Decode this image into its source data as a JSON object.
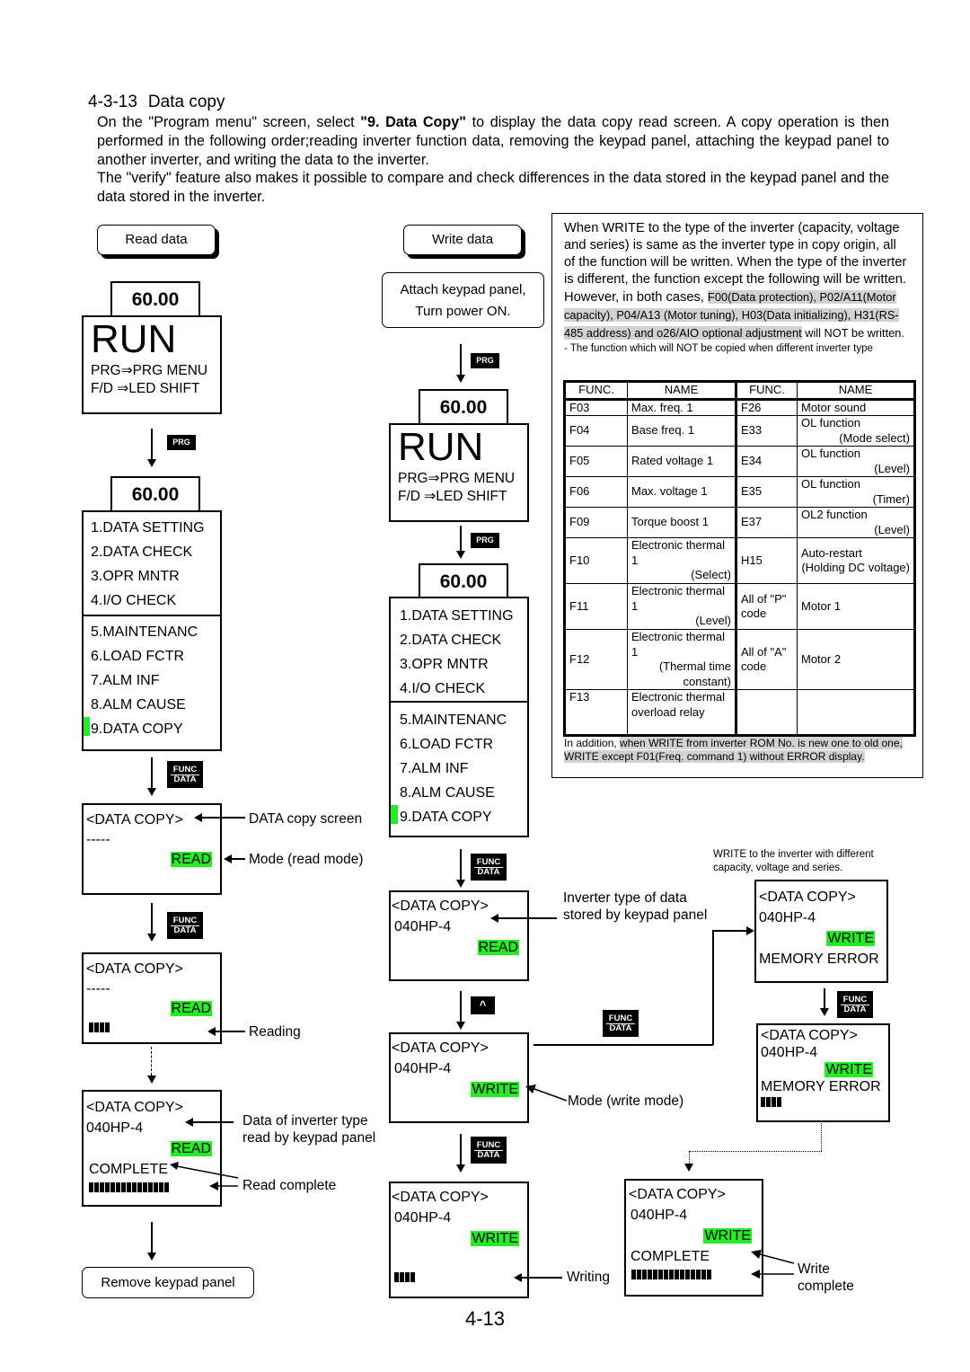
{
  "section": {
    "number": "4-3-13",
    "title": "Data copy"
  },
  "intro": {
    "p1_before": "On the \"Program menu\" screen, select ",
    "p1_bold": "\"9. Data Copy\"",
    "p1_after": " to display the data copy read screen.  A copy operation is then performed in the following order;reading inverter function data, removing the keypad panel, attaching the keypad panel to another inverter, and writing the data to the inverter.",
    "p2": "The \"verify\" feature also makes it possible to compare and check differences in the data stored in the keypad panel and the data stored in the inverter."
  },
  "read_flow": {
    "title": "Read data",
    "freq": "60.00",
    "run": "RUN",
    "run_line1": "PRG⇒PRG MENU",
    "run_line2": "F/D ⇒LED SHIFT",
    "key_prg": "PRG",
    "menu_freq": "60.00",
    "menu_items": [
      "1.DATA SETTING",
      "2.DATA CHECK",
      "3.OPR MNTR",
      "4.I/O CHECK",
      "5.MAINTENANC",
      "6.LOAD FCTR",
      "7.ALM INF",
      "8.ALM CAUSE",
      "9.DATA COPY"
    ],
    "key_func": "FUNC",
    "key_data": "DATA",
    "screen1": {
      "title": "<DATA COPY>",
      "line2": "-----",
      "mode": "READ"
    },
    "screen2": {
      "title": "<DATA COPY>",
      "line2": "-----",
      "mode": "READ",
      "progress": 0.27
    },
    "screen3": {
      "title": "<DATA COPY>",
      "line2": "040HP-4",
      "mode": "READ",
      "status": "COMPLETE",
      "progress": 1.0
    },
    "annotations": {
      "copy_screen": "DATA copy screen",
      "mode_read": "Mode (read mode)",
      "reading": "Reading",
      "inverter_type_1": "Data of inverter type",
      "inverter_type_2": "read by keypad panel",
      "read_complete": "Read complete"
    },
    "end": "Remove keypad panel"
  },
  "write_flow": {
    "title": "Write data",
    "attach_1": "Attach keypad panel,",
    "attach_2": "Turn power ON.",
    "key_prg": "PRG",
    "freq": "60.00",
    "run": "RUN",
    "run_line1": "PRG⇒PRG MENU",
    "run_line2": "F/D ⇒LED SHIFT",
    "menu_freq": "60.00",
    "menu_items": [
      "1.DATA SETTING",
      "2.DATA CHECK",
      "3.OPR MNTR",
      "4.I/O CHECK",
      "5.MAINTENANC",
      "6.LOAD FCTR",
      "7.ALM INF",
      "8.ALM CAUSE",
      "9.DATA COPY"
    ],
    "key_func": "FUNC",
    "key_data": "DATA",
    "key_up": "^",
    "screen1": {
      "title": "<DATA COPY>",
      "line2": "040HP-4",
      "mode": "READ"
    },
    "screen2": {
      "title": "<DATA COPY>",
      "line2": "040HP-4",
      "mode": "WRITE"
    },
    "screen3": {
      "title": "<DATA COPY>",
      "line2": "040HP-4",
      "mode": "WRITE",
      "progress": 0.27
    },
    "screen_err1": {
      "title": "<DATA COPY>",
      "line2": "040HP-4",
      "mode": "WRITE",
      "status": "MEMORY ERROR"
    },
    "screen_err2": {
      "title": "<DATA COPY>",
      "line2": "040HP-4",
      "mode": "WRITE",
      "status": "MEMORY ERROR",
      "progress": 0.27
    },
    "screen_done": {
      "title": "<DATA COPY>",
      "line2": "040HP-4",
      "mode": "WRITE",
      "status": "COMPLETE",
      "progress": 1.0
    },
    "annotations": {
      "stored_type_1": "Inverter type of data",
      "stored_type_2": "stored by keypad panel",
      "mode_write": "Mode (write mode)",
      "writing": "Writing",
      "diff_1": "WRITE to the inverter with different",
      "diff_2": "capacity, voltage and series.",
      "write_complete_1": "Write",
      "write_complete_2": "complete"
    }
  },
  "note": {
    "text_plain": "When WRITE to the type of the inverter (capacity, voltage and series) is same as the inverter type in copy origin, all of the function will be written. When the type of the inverter is different, the function except the following will be written. However, in both cases, ",
    "text_highlight": "F00(Data protection), P02/A11(Motor capacity), P04/A13 (Motor tuning), H03(Data initializing), H31(RS-485 address) and o26/AIO optional adjustment",
    "text_end": " will NOT be written.",
    "table_caption": "- The function which will NOT be copied when different inverter type",
    "table_headers": [
      "FUNC.",
      "NAME",
      "FUNC.",
      "NAME"
    ],
    "rows": [
      {
        "f1": "F03",
        "n1": "Max. freq. 1",
        "n1b": "",
        "f2": "F26",
        "n2": "Motor sound",
        "n2b": ""
      },
      {
        "f1": "F04",
        "n1": "Base freq. 1",
        "n1b": "",
        "f2": "E33",
        "n2": "OL function",
        "n2b": "(Mode select)"
      },
      {
        "f1": "F05",
        "n1": "Rated voltage 1",
        "n1b": "",
        "f2": "E34",
        "n2": "OL function",
        "n2b": "(Level)"
      },
      {
        "f1": "F06",
        "n1": "Max. voltage 1",
        "n1b": "",
        "f2": "E35",
        "n2": "OL function",
        "n2b": "(Timer)"
      },
      {
        "f1": "F09",
        "n1": "Torque boost 1",
        "n1b": "",
        "f2": "E37",
        "n2": "OL2 function",
        "n2b": "(Level)"
      },
      {
        "f1": "F10",
        "n1": "Electronic thermal 1",
        "n1b": "(Select)",
        "f2": "H15",
        "n2": "Auto-restart",
        "n2b": "(Holding DC voltage)"
      },
      {
        "f1": "F11",
        "n1": "Electronic thermal 1",
        "n1b": "(Level)",
        "f2": "All of \"P\" code",
        "n2": "Motor 1",
        "n2b": ""
      },
      {
        "f1": "F12",
        "n1": "Electronic thermal 1",
        "n1b": "(Thermal time constant)",
        "f2": "All of \"A\" code",
        "n2": "Motor 2",
        "n2b": ""
      },
      {
        "f1": "F13",
        "n1": "Electronic thermal overload relay",
        "n1b": "",
        "f2": "",
        "n2": "",
        "n2b": ""
      }
    ],
    "foot_plain": "In addition, ",
    "foot_highlight": "when WRITE from inverter ROM No. is new one to old one, WRITE except F01(Freq. command 1) without ERROR display."
  },
  "page_number": "4-13",
  "colors": {
    "mode_highlight": "#22ee22",
    "text_highlight": "#d2d2d2"
  }
}
